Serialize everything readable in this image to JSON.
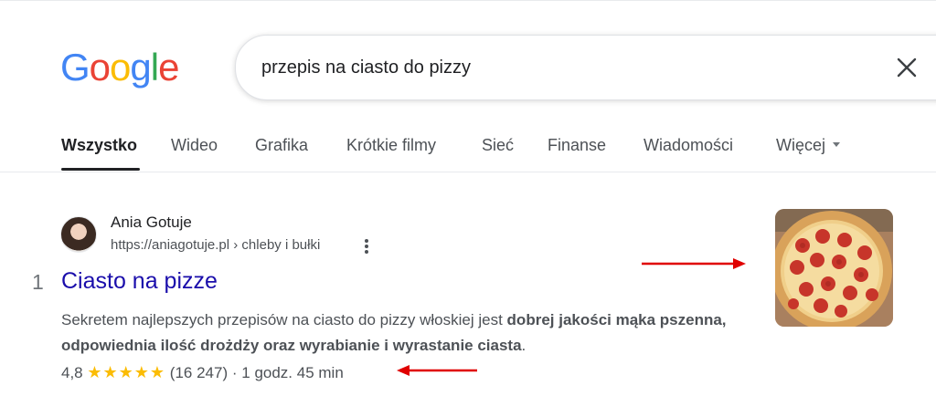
{
  "logo": {
    "letters": [
      "G",
      "o",
      "o",
      "g",
      "l",
      "e"
    ],
    "colors": [
      "#4285F4",
      "#EA4335",
      "#FBBC05",
      "#4285F4",
      "#34A853",
      "#EA4335"
    ]
  },
  "search": {
    "query": "przepis na ciasto do pizzy",
    "clear_icon": "close-icon"
  },
  "tabs": [
    {
      "label": "Wszystko",
      "active": true
    },
    {
      "label": "Wideo"
    },
    {
      "label": "Grafika"
    },
    {
      "label": "Krótkie filmy"
    },
    {
      "label": "Sieć"
    },
    {
      "label": "Finanse"
    },
    {
      "label": "Wiadomości"
    },
    {
      "label": "Więcej"
    }
  ],
  "result": {
    "rank": "1",
    "site_name": "Ania Gotuje",
    "url": "https://aniagotuje.pl › chleby i bułki",
    "title": "Ciasto na pizze",
    "snippet_plain_1": "Sekretem najlepszych przepisów na ciasto do pizzy włoskiej jest ",
    "snippet_bold": "dobrej jakości mąka pszenna, odpowiednia ilość drożdży oraz wyrabianie i wyrastanie ciasta",
    "snippet_plain_2": ".",
    "rating": "4,8",
    "stars": "★★★★★",
    "reviews": "(16 247)",
    "separator": "·",
    "time": "1 godz. 45 min"
  },
  "colors": {
    "link": "#1a0dab",
    "star": "#fbbc04",
    "arrow": "#e00000"
  }
}
